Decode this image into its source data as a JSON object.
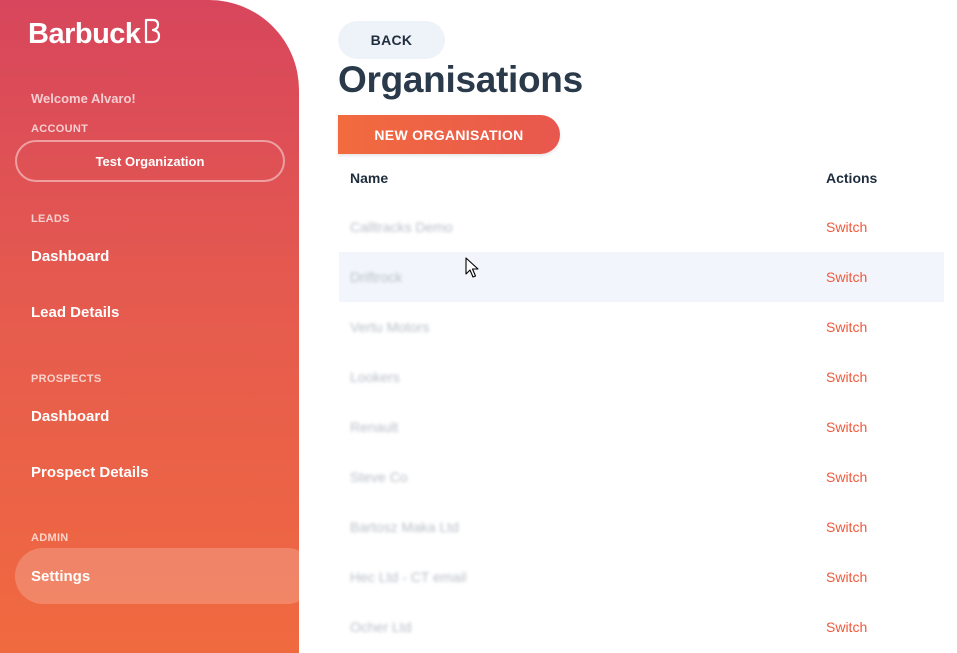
{
  "brand": {
    "name": "Barbuck",
    "accent": "#f06a3f",
    "accent_secondary": "#d7465c"
  },
  "sidebar": {
    "welcome": "Welcome Alvaro!",
    "account_label": "ACCOUNT",
    "account_selected": "Test Organization",
    "sections": [
      {
        "label": "LEADS",
        "items": [
          {
            "label": "Dashboard"
          },
          {
            "label": "Lead Details"
          }
        ]
      },
      {
        "label": "PROSPECTS",
        "items": [
          {
            "label": "Dashboard"
          },
          {
            "label": "Prospect Details"
          }
        ]
      },
      {
        "label": "ADMIN",
        "items": [
          {
            "label": "Settings",
            "active": true
          }
        ]
      }
    ]
  },
  "main": {
    "back_label": "BACK",
    "title": "Organisations",
    "new_button_label": "NEW ORGANISATION",
    "table": {
      "columns": [
        "Name",
        "Actions"
      ],
      "rows": [
        {
          "name": "Calltracks Demo",
          "action": "Switch"
        },
        {
          "name": "Driftrock",
          "action": "Switch",
          "hovered": true
        },
        {
          "name": "Vertu Motors",
          "action": "Switch"
        },
        {
          "name": "Lookers",
          "action": "Switch"
        },
        {
          "name": "Renault",
          "action": "Switch"
        },
        {
          "name": "Steve Co",
          "action": "Switch"
        },
        {
          "name": "Bartosz Maka Ltd",
          "action": "Switch"
        },
        {
          "name": "Hec Ltd - CT email",
          "action": "Switch"
        },
        {
          "name": "Ocher Ltd",
          "action": "Switch"
        }
      ]
    }
  },
  "icons": {
    "logo_mark": "barbuck-b-icon",
    "cursor": "mouse-pointer-icon"
  }
}
